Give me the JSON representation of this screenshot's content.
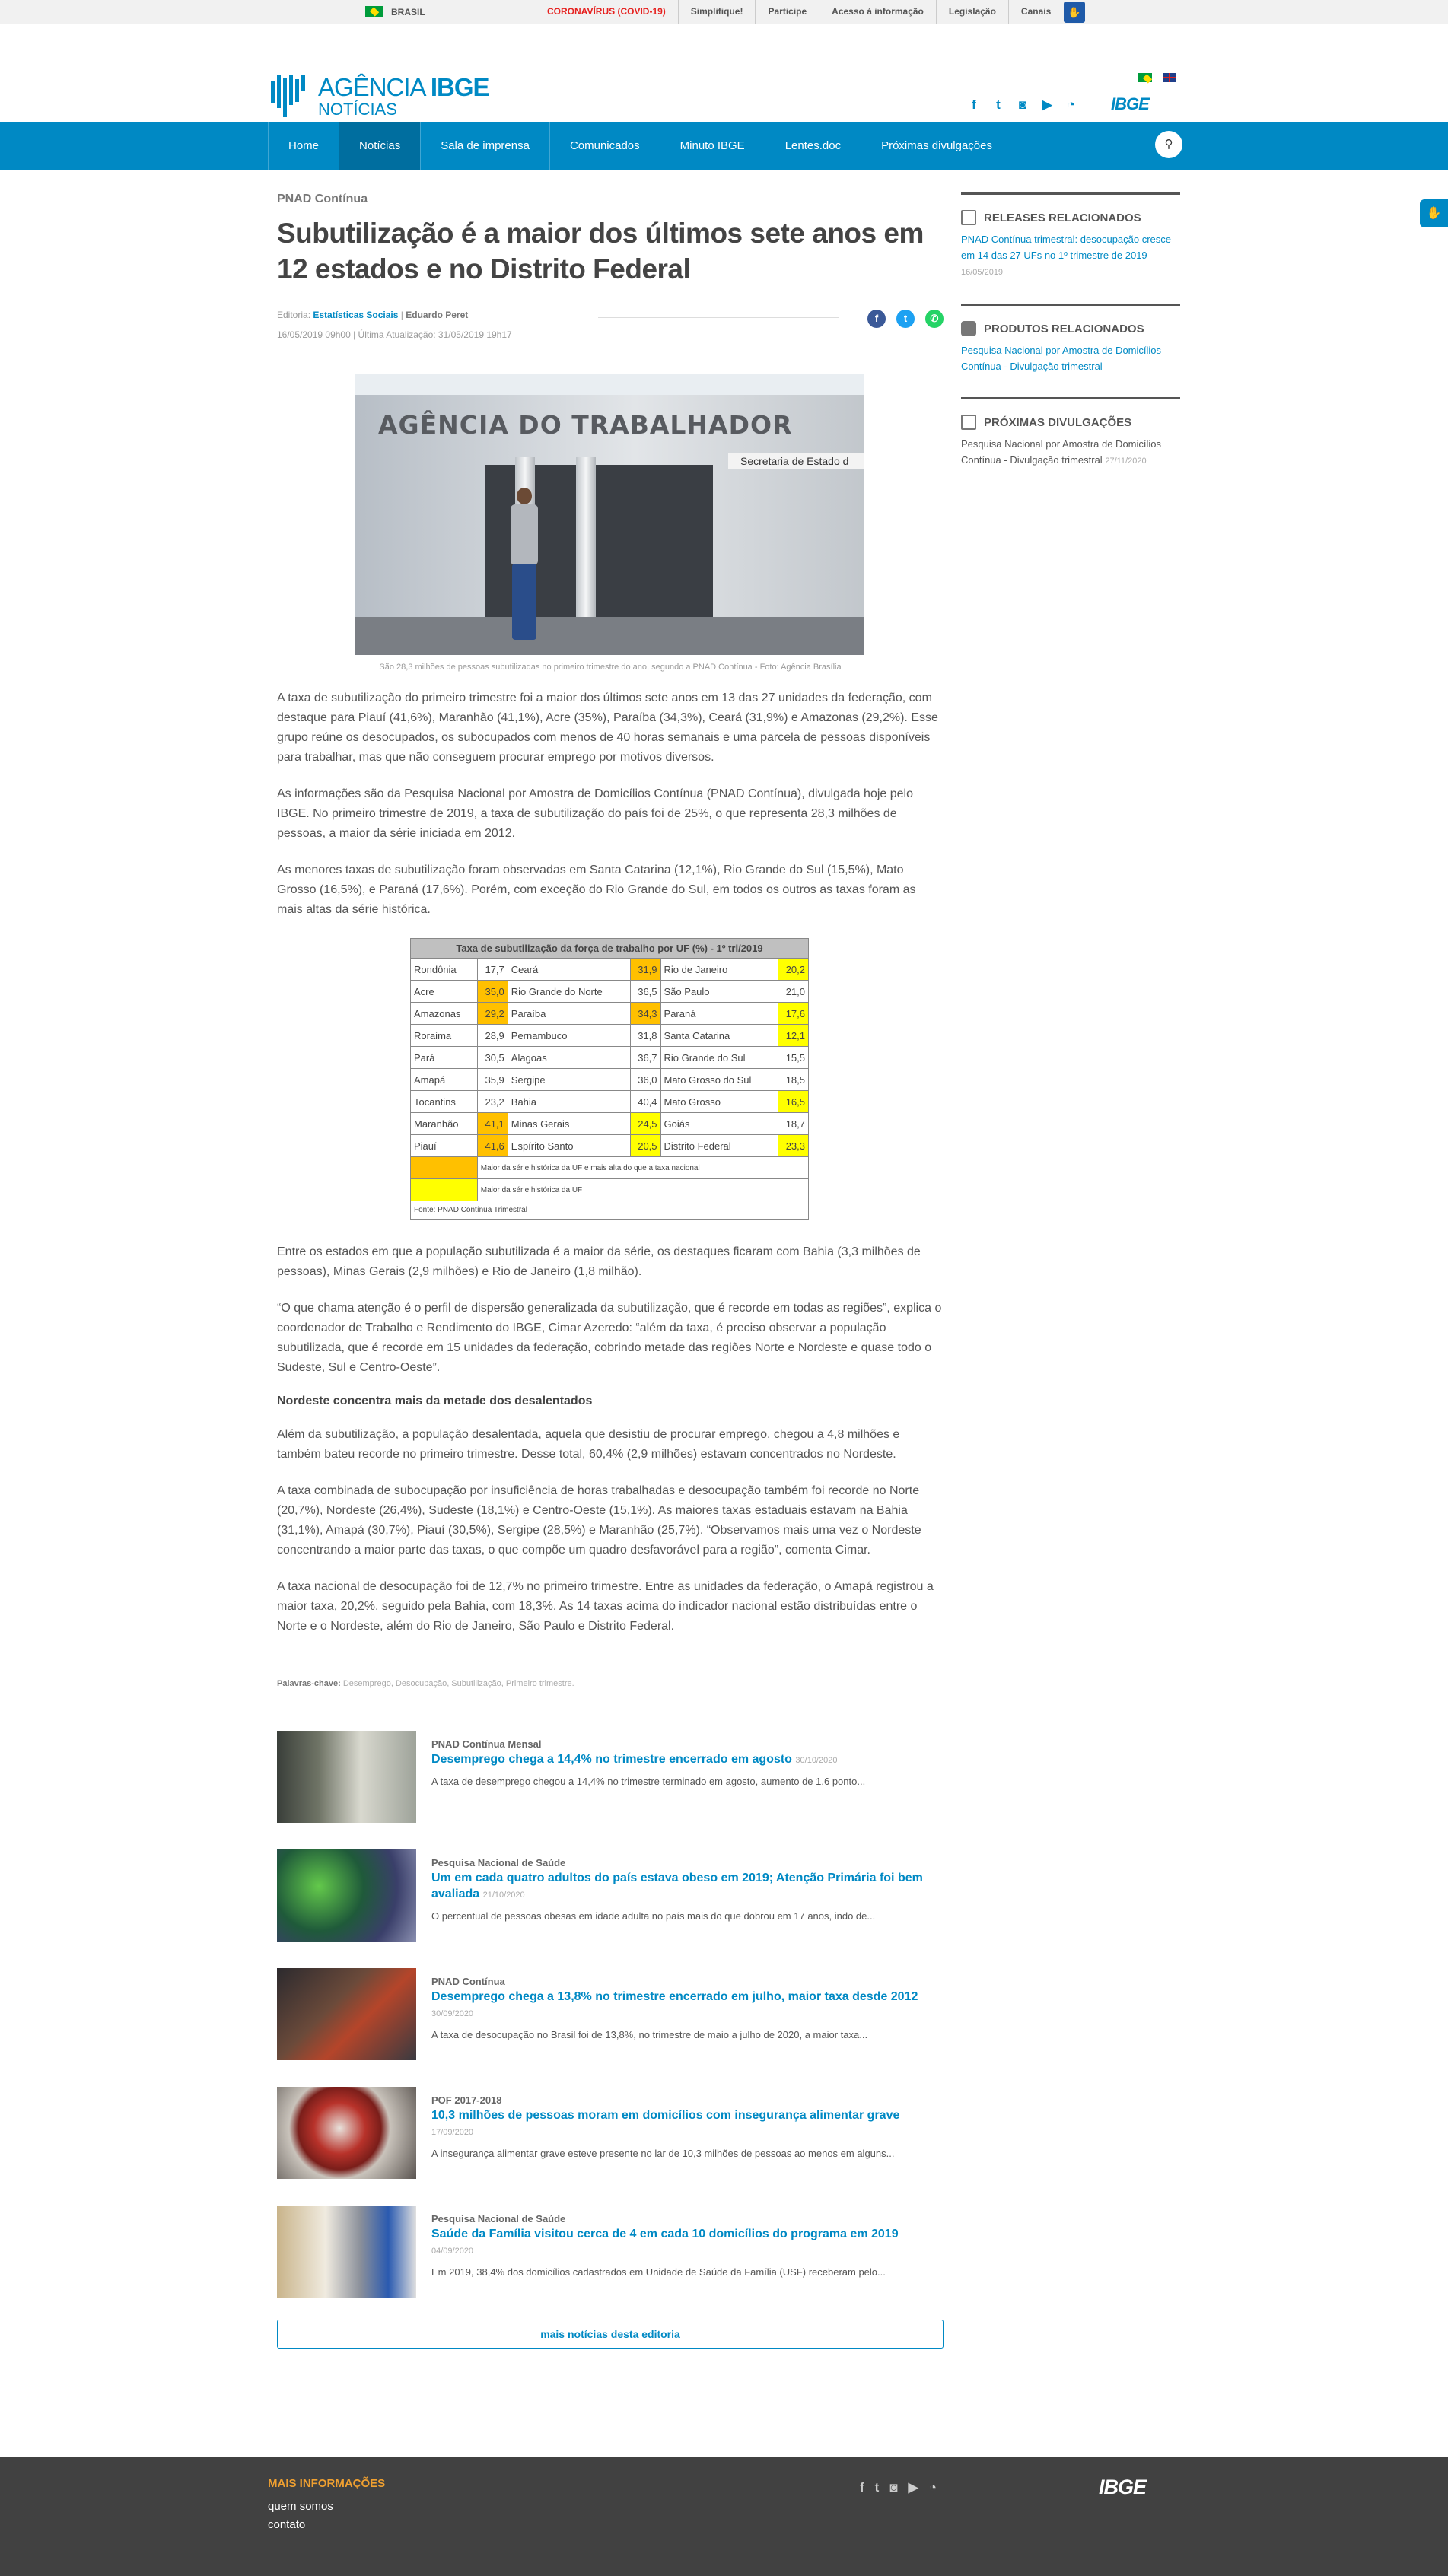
{
  "gov_bar": {
    "brasil": "BRASIL",
    "links": [
      "CORONAVÍRUS (COVID-19)",
      "Simplifique!",
      "Participe",
      "Acesso à informação",
      "Legislação",
      "Canais"
    ]
  },
  "logo": {
    "line1_a": "AGÊNCIA",
    "line1_b": "IBGE",
    "line2": "NOTÍCIAS"
  },
  "header": {
    "ibge_logo": "IBGE"
  },
  "nav": [
    "Home",
    "Notícias",
    "Sala de imprensa",
    "Comunicados",
    "Minuto IBGE",
    "Lentes.doc",
    "Próximas divulgações"
  ],
  "article": {
    "category": "PNAD Contínua",
    "title": "Subutilização é a maior dos últimos sete anos em 12 estados e no Distrito Federal",
    "editoria_label": "Editoria:",
    "editoria": "Estatísticas Sociais",
    "separator": " | ",
    "author": "Eduardo Peret",
    "dates": "16/05/2019 09h00 | Última Atualização: 31/05/2019 19h17",
    "photo_sign": "AGÊNCIA DO TRABALHADOR",
    "photo_plate": "Secretaria de Estado d",
    "caption": "São 28,3 milhões de pessoas subutilizadas no primeiro trimestre do ano, segundo a PNAD Contínua - Foto: Agência Brasília",
    "paragraphs": [
      "A taxa de subutilização do primeiro trimestre foi a maior dos últimos sete anos em 13 das 27 unidades da federação, com destaque para Piauí (41,6%), Maranhão (41,1%), Acre (35%), Paraíba (34,3%), Ceará (31,9%) e Amazonas (29,2%). Esse grupo reúne os desocupados, os subocupados com menos de 40 horas semanais e uma parcela de pessoas disponíveis para trabalhar, mas que não conseguem procurar emprego por motivos diversos.",
      "As informações são da Pesquisa Nacional por Amostra de Domicílios Contínua (PNAD Contínua), divulgada hoje pelo IBGE. No primeiro trimestre de 2019, a taxa de subutilização do país foi de 25%, o que representa 28,3 milhões de pessoas, a maior da série iniciada em 2012.",
      "As menores taxas de subutilização foram observadas em Santa Catarina (12,1%), Rio Grande do Sul (15,5%), Mato Grosso (16,5%), e Paraná (17,6%). Porém, com exceção do Rio Grande do Sul, em todos os outros as taxas foram as mais altas da série histórica."
    ],
    "paragraphs2": [
      "Entre os estados em que a população subutilizada é a maior da série, os destaques ficaram com Bahia (3,3 milhões de pessoas), Minas Gerais (2,9 milhões) e Rio de Janeiro (1,8 milhão).",
      "“O que chama atenção é o perfil de dispersão generalizada da subutilização, que é recorde em todas as regiões”, explica o coordenador de Trabalho e Rendimento do IBGE, Cimar Azeredo: “além da taxa, é preciso observar a população subutilizada, que é recorde em 15 unidades da federação, cobrindo metade das regiões Norte e Nordeste e quase todo o Sudeste, Sul e Centro-Oeste”."
    ],
    "subheading": "Nordeste concentra mais da metade dos desalentados",
    "paragraphs3": [
      "Além da subutilização, a população desalentada, aquela que desistiu de procurar emprego, chegou a 4,8 milhões e também bateu recorde no primeiro trimestre. Desse total, 60,4% (2,9 milhões) estavam concentrados no Nordeste.",
      "A taxa combinada de subocupação por insuficiência de horas trabalhadas e desocupação também foi recorde no Norte (20,7%), Nordeste (26,4%), Sudeste (18,1%) e Centro-Oeste (15,1%). As maiores taxas estaduais estavam na Bahia (31,1%), Amapá (30,7%), Piauí (30,5%), Sergipe (28,5%) e Maranhão (25,7%). “Observamos mais uma vez o Nordeste concentrando a maior parte das taxas, o que compõe um quadro desfavorável para a região”, comenta Cimar.",
      "A taxa nacional de desocupação foi de 12,7% no primeiro trimestre. Entre as unidades da federação, o Amapá registrou a maior taxa, 20,2%, seguido pela Bahia, com 18,3%. As 14 taxas acima do indicador nacional estão distribuídas entre o Norte e o Nordeste, além do Rio de Janeiro, São Paulo e Distrito Federal."
    ],
    "keywords_label": "Palavras-chave:",
    "keywords": "Desemprego, Desocupação, Subutilização, Primeiro trimestre."
  },
  "table": {
    "title": "Taxa de subutilização da força de trabalho por UF (%) - 1º tri/2019",
    "rows": [
      [
        [
          "Rondônia",
          "17,7",
          ""
        ],
        [
          "Ceará",
          "31,9",
          "o"
        ],
        [
          "Rio de Janeiro",
          "20,2",
          "y"
        ]
      ],
      [
        [
          "Acre",
          "35,0",
          "o"
        ],
        [
          "Rio Grande do Norte",
          "36,5",
          ""
        ],
        [
          "São Paulo",
          "21,0",
          ""
        ]
      ],
      [
        [
          "Amazonas",
          "29,2",
          "o"
        ],
        [
          "Paraíba",
          "34,3",
          "o"
        ],
        [
          "Paraná",
          "17,6",
          "y"
        ]
      ],
      [
        [
          "Roraima",
          "28,9",
          ""
        ],
        [
          "Pernambuco",
          "31,8",
          ""
        ],
        [
          "Santa Catarina",
          "12,1",
          "y"
        ]
      ],
      [
        [
          "Pará",
          "30,5",
          ""
        ],
        [
          "Alagoas",
          "36,7",
          ""
        ],
        [
          "Rio Grande do Sul",
          "15,5",
          ""
        ]
      ],
      [
        [
          "Amapá",
          "35,9",
          ""
        ],
        [
          "Sergipe",
          "36,0",
          ""
        ],
        [
          "Mato Grosso do Sul",
          "18,5",
          ""
        ]
      ],
      [
        [
          "Tocantins",
          "23,2",
          ""
        ],
        [
          "Bahia",
          "40,4",
          ""
        ],
        [
          "Mato Grosso",
          "16,5",
          "y"
        ]
      ],
      [
        [
          "Maranhão",
          "41,1",
          "o"
        ],
        [
          "Minas Gerais",
          "24,5",
          "y"
        ],
        [
          "Goiás",
          "18,7",
          ""
        ]
      ],
      [
        [
          "Piauí",
          "41,6",
          "o"
        ],
        [
          "Espírito Santo",
          "20,5",
          "y"
        ],
        [
          "Distrito Federal",
          "23,3",
          "y"
        ]
      ]
    ],
    "legend_orange": "Maior da série histórica da UF e mais alta do que a taxa nacional",
    "legend_yellow": "Maior da série histórica da UF",
    "source": "Fonte: PNAD Contínua Trimestral",
    "colors": {
      "orange": "#ffc000",
      "yellow": "#ffff00"
    }
  },
  "related": [
    {
      "cat": "PNAD Contínua Mensal",
      "title": "Desemprego chega a 14,4% no trimestre encerrado em agosto",
      "date": "30/10/2020",
      "summary": "A taxa de desemprego chegou a 14,4% no trimestre terminado em agosto, aumento de 1,6 ponto..."
    },
    {
      "cat": "Pesquisa Nacional de Saúde",
      "title": "Um em cada quatro adultos do país estava obeso em 2019; Atenção Primária foi bem avaliada",
      "date": "21/10/2020",
      "summary": "O percentual de pessoas obesas em idade adulta no país mais do que dobrou em 17 anos, indo de..."
    },
    {
      "cat": "PNAD Contínua",
      "title": "Desemprego chega a 13,8% no trimestre encerrado em julho, maior taxa desde 2012",
      "date": "30/09/2020",
      "summary": "A taxa de desocupação no Brasil foi de 13,8%, no trimestre de maio a julho de 2020, a maior taxa..."
    },
    {
      "cat": "POF 2017-2018",
      "title": "10,3 milhões de pessoas moram em domicílios com insegurança alimentar grave",
      "date": "17/09/2020",
      "summary": "A insegurança alimentar grave esteve presente no lar de 10,3 milhões de pessoas ao menos em alguns..."
    },
    {
      "cat": "Pesquisa Nacional de Saúde",
      "title": "Saúde da Família visitou cerca de 4 em cada 10 domicílios do programa em 2019",
      "date": "04/09/2020",
      "summary": "Em 2019, 38,4% dos domicílios cadastrados em Unidade de Saúde da Família (USF) receberam pelo..."
    }
  ],
  "more_button": "mais notícias desta editoria",
  "sidebar": {
    "releases_title": "RELEASES RELACIONADOS",
    "release_link": "PNAD Contínua trimestral: desocupação cresce em 14 das 27 UFs no 1º trimestre de 2019",
    "release_date": "16/05/2019",
    "produtos_title": "PRODUTOS RELACIONADOS",
    "produto_link": "Pesquisa Nacional por Amostra de Domicílios Contínua - Divulgação trimestral",
    "proximas_title": "PRÓXIMAS DIVULGAÇÕES",
    "proxima_text": "Pesquisa Nacional por Amostra de Domicílios Contínua - Divulgação trimestral",
    "proxima_date": "27/11/2020"
  },
  "footer": {
    "heading": "MAIS INFORMAÇÕES",
    "links": [
      "quem somos",
      "contato"
    ],
    "logo": "IBGE"
  }
}
